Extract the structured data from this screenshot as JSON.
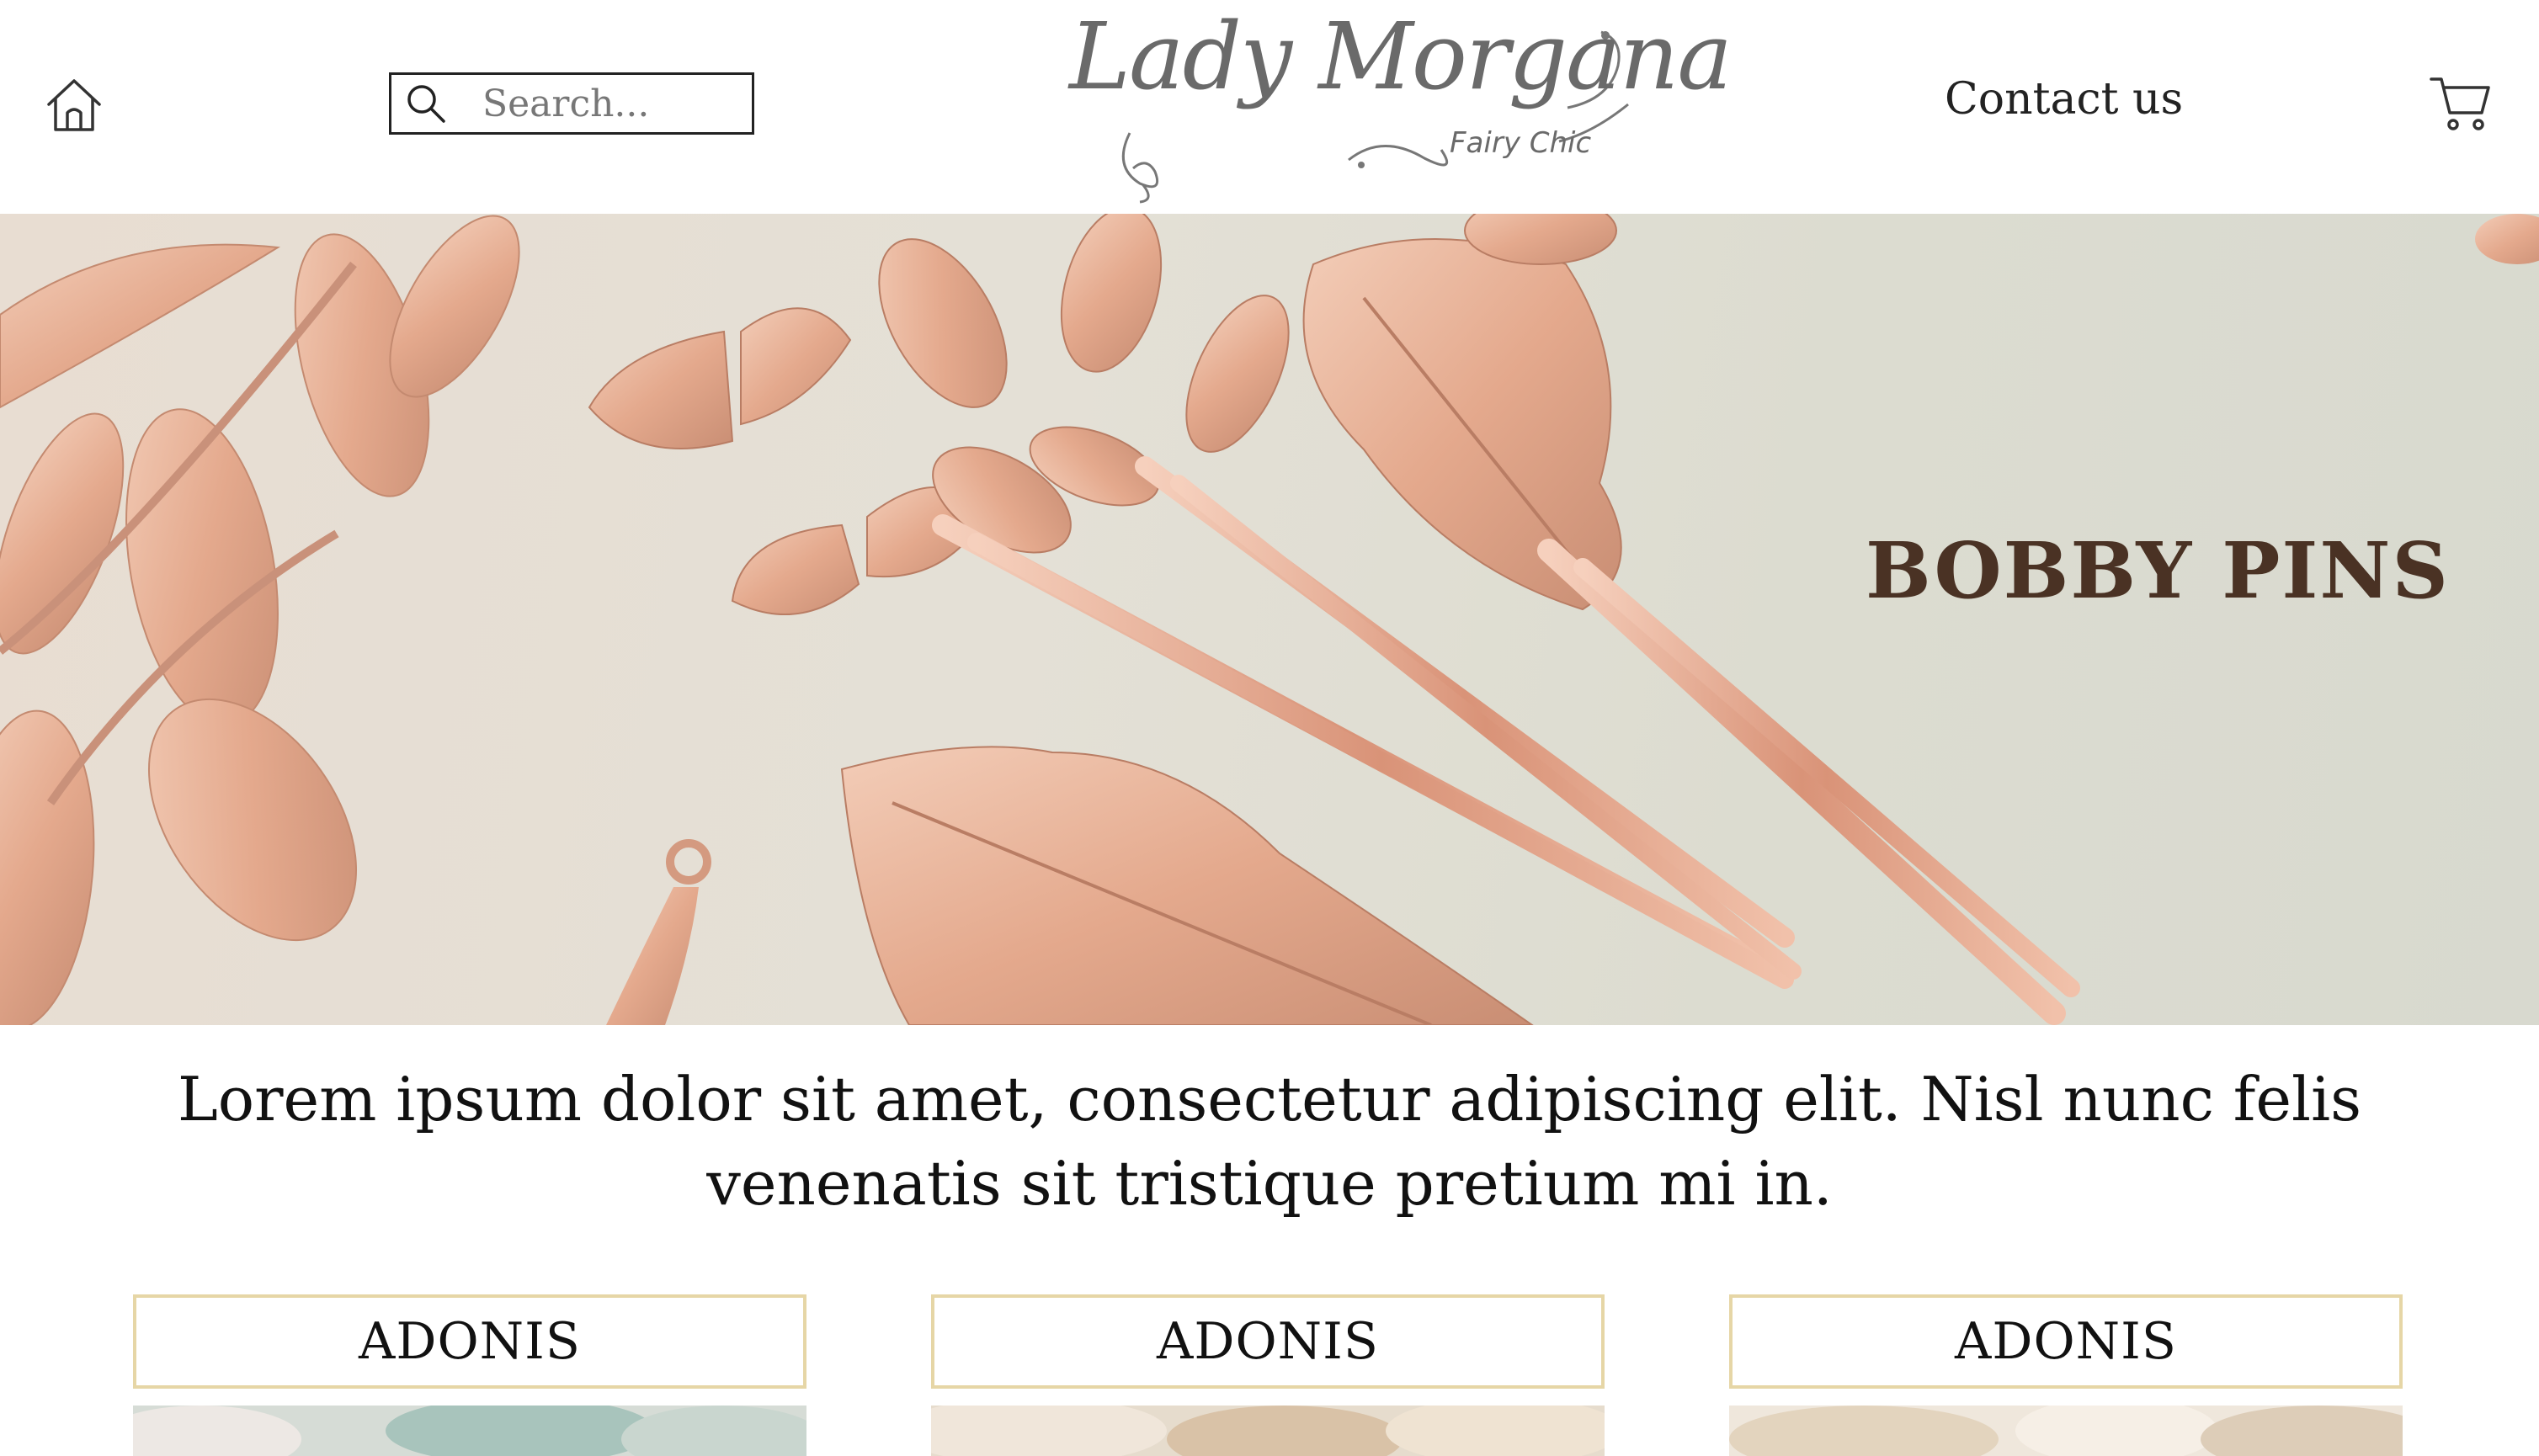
{
  "header": {
    "search_placeholder": "Search...",
    "logo": {
      "main": "Lady Morgana",
      "sub": "Fairy Chic"
    },
    "contact_label": "Contact us"
  },
  "icons": {
    "home": "home-icon",
    "search": "search-icon",
    "cart": "cart-icon"
  },
  "hero": {
    "title": "BOBBY PINS"
  },
  "intro": {
    "text": "Lorem ipsum dolor sit amet, consectetur adipiscing elit. Nisl nunc felis venenatis sit tristique pretium mi in."
  },
  "products": [
    {
      "name": "ADONIS"
    },
    {
      "name": "ADONIS"
    },
    {
      "name": "ADONIS"
    }
  ],
  "colors": {
    "hero_title": "#4a3224",
    "product_border": "#e6d6a6",
    "rose_gold": "#e2aa8e"
  }
}
